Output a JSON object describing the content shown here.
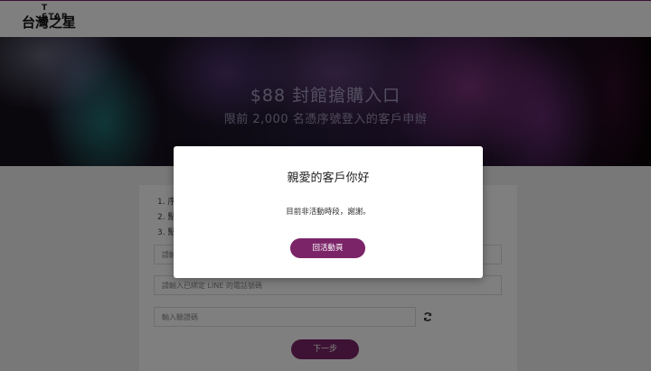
{
  "header": {
    "logo_en": "T STAR",
    "logo_zh": "台灣之星"
  },
  "hero": {
    "title": "$88 封館搶購入口",
    "subtitle": "限前 2,000 名憑序號登入的客戶申辦"
  },
  "form": {
    "steps": [
      "1. 序",
      "2. 點",
      "3. 點"
    ],
    "field_1_placeholder": "請輸",
    "field_2_placeholder": "請輸入已綁定 LINE 的電話號碼",
    "captcha_placeholder": "輸入驗證碼",
    "refresh_icon": "refresh-icon",
    "next_label": "下一步"
  },
  "modal": {
    "title": "親愛的客戶你好",
    "message": "目前非活動時段，謝謝。",
    "button_label": "回活動頁"
  },
  "colors": {
    "accent": "#7b2468",
    "header_border": "#7a1d63"
  }
}
